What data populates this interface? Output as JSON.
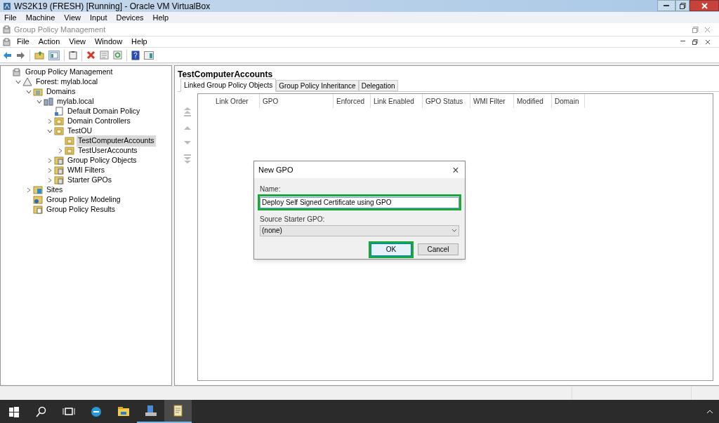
{
  "host_window": {
    "title": "WS2K19 (FRESH) [Running] - Oracle VM VirtualBox",
    "menu": [
      "File",
      "Machine",
      "View",
      "Input",
      "Devices",
      "Help"
    ]
  },
  "app_window": {
    "title": "Group Policy Management",
    "menu": [
      "File",
      "Action",
      "View",
      "Window",
      "Help"
    ]
  },
  "tree": [
    {
      "label": "Group Policy Management",
      "kind": "console",
      "selected": false,
      "children": [
        {
          "label": "Forest: mylab.local",
          "kind": "forest",
          "expanded": true,
          "selected": false,
          "children": [
            {
              "label": "Domains",
              "kind": "domains",
              "expanded": true,
              "selected": false,
              "children": [
                {
                  "label": "mylab.local",
                  "kind": "domain",
                  "expanded": true,
                  "selected": false,
                  "children": [
                    {
                      "label": "Default Domain Policy",
                      "kind": "gpo",
                      "selected": false
                    },
                    {
                      "label": "Domain Controllers",
                      "kind": "ou",
                      "expanded": false,
                      "selected": false
                    },
                    {
                      "label": "TestOU",
                      "kind": "ou",
                      "expanded": true,
                      "selected": false,
                      "children": [
                        {
                          "label": "TestComputerAccounts",
                          "kind": "ou",
                          "selected": true
                        },
                        {
                          "label": "TestUserAccounts",
                          "kind": "ou",
                          "expanded": false,
                          "selected": false
                        }
                      ]
                    },
                    {
                      "label": "Group Policy Objects",
                      "kind": "container",
                      "expanded": false,
                      "selected": false
                    },
                    {
                      "label": "WMI Filters",
                      "kind": "container",
                      "expanded": false,
                      "selected": false
                    },
                    {
                      "label": "Starter GPOs",
                      "kind": "container",
                      "expanded": false,
                      "selected": false
                    }
                  ]
                }
              ]
            },
            {
              "label": "Sites",
              "kind": "sites",
              "expanded": false,
              "selected": false
            },
            {
              "label": "Group Policy Modeling",
              "kind": "modeling",
              "selected": false
            },
            {
              "label": "Group Policy Results",
              "kind": "results",
              "selected": false
            }
          ]
        }
      ]
    }
  ],
  "detail": {
    "title": "TestComputerAccounts",
    "tabs": [
      {
        "label": "Linked Group Policy Objects",
        "selected": true
      },
      {
        "label": "Group Policy Inheritance",
        "selected": false
      },
      {
        "label": "Delegation",
        "selected": false
      }
    ],
    "columns": [
      "Link Order",
      "GPO",
      "Enforced",
      "Link Enabled",
      "GPO Status",
      "WMI Filter",
      "Modified",
      "Domain"
    ]
  },
  "dialog": {
    "title": "New GPO",
    "close": "×",
    "name_label": "Name:",
    "name_value": "Deploy Self Signed Certificate using GPO",
    "starter_label": "Source Starter GPO:",
    "starter_value": "(none)",
    "buttons": [
      {
        "label": "OK",
        "highlighted": true
      },
      {
        "label": "Cancel",
        "highlighted": false
      }
    ]
  },
  "taskbar": [
    {
      "kind": "start",
      "selected": false
    },
    {
      "kind": "search",
      "selected": false
    },
    {
      "kind": "taskview",
      "selected": false
    },
    {
      "kind": "browser",
      "selected": false
    },
    {
      "kind": "explorer",
      "selected": false
    },
    {
      "kind": "server",
      "selected": false
    },
    {
      "kind": "gpm",
      "selected": true
    }
  ]
}
